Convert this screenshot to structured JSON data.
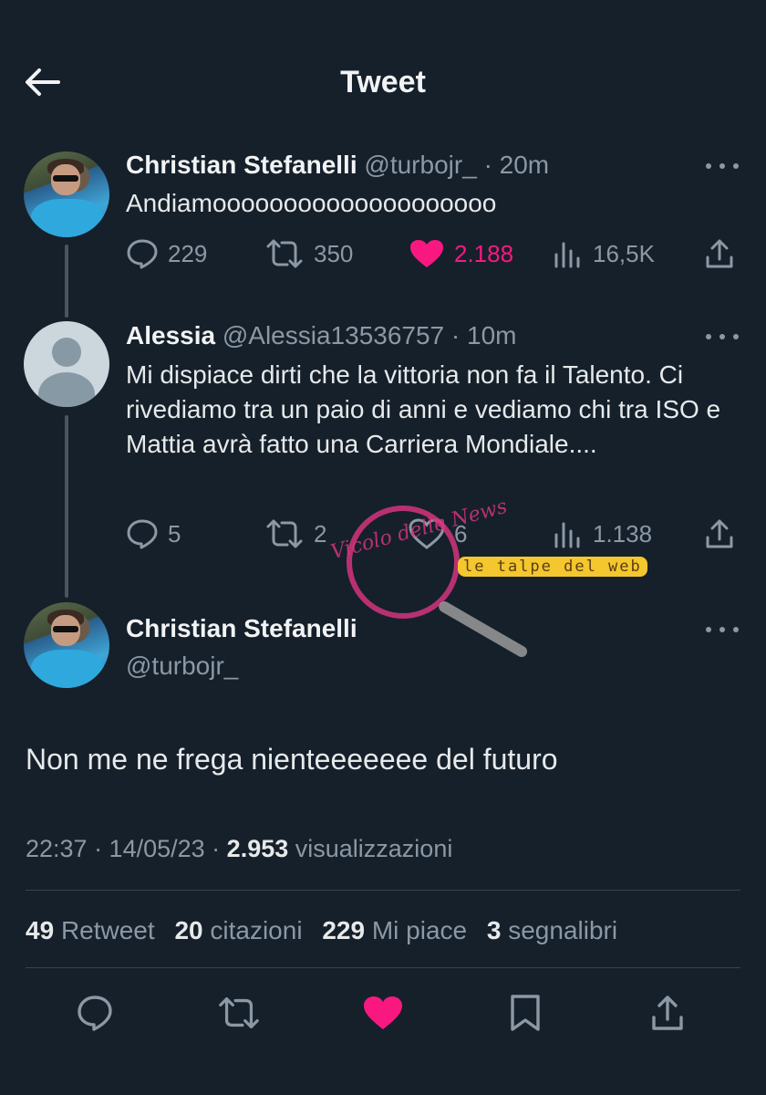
{
  "header": {
    "title": "Tweet"
  },
  "tweets": [
    {
      "name": "Christian Stefanelli",
      "handle": "@turbojr_",
      "time": "· 20m",
      "text": "Andiamoooooooooooooooooooo",
      "replies": "229",
      "retweets": "350",
      "likes": "2.188",
      "views": "16,5K",
      "liked": true
    },
    {
      "name": "Alessia",
      "handle": "@Alessia13536757",
      "time": "· 10m",
      "text": "Mi dispiace dirti che la vittoria non fa il Talento. Ci rivediamo tra un paio di anni e vediamo chi tra ISO e Mattia avrà fatto una Carriera Mondiale....",
      "replies": "5",
      "retweets": "2",
      "likes": "6",
      "views": "1.138",
      "liked": false
    }
  ],
  "main_tweet": {
    "name": "Christian Stefanelli",
    "handle": "@turbojr_",
    "text": "Non me ne frega nienteeeeeee del futuro",
    "time": "22:37 · 14/05/23 ·",
    "views_count": "2.953",
    "views_label": "visualizzazioni",
    "stats": {
      "retweets": "49",
      "retweets_label": "Retweet",
      "quotes": "20",
      "quotes_label": "citazioni",
      "likes": "229",
      "likes_label": "Mi piace",
      "bookmarks": "3",
      "bookmarks_label": "segnalibri"
    }
  },
  "watermark": {
    "brand_cursive": "Vicolo delle News",
    "brand_banner": "le talpe del web"
  },
  "colors": {
    "background": "#15202b",
    "like": "#f91880",
    "muted": "#8b98a5",
    "text": "#e7e9ea"
  },
  "icons": [
    "back-arrow-icon",
    "more-icon",
    "reply-icon",
    "retweet-icon",
    "like-icon",
    "views-icon",
    "share-icon",
    "bookmark-icon"
  ]
}
